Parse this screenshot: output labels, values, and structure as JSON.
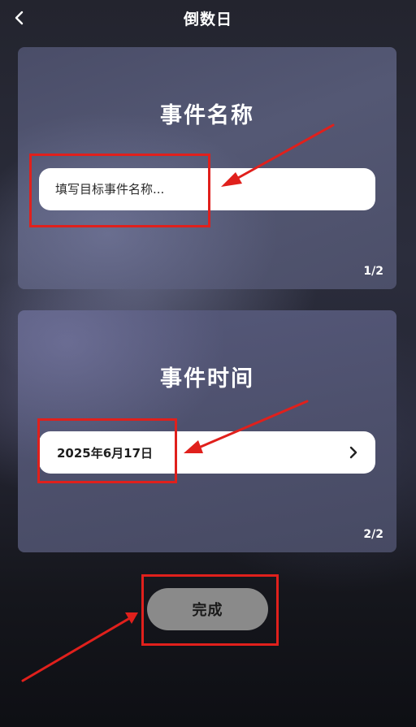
{
  "header": {
    "title": "倒数日",
    "back_icon": "chevron-left-icon"
  },
  "event_name_card": {
    "heading": "事件名称",
    "input_placeholder": "填写目标事件名称...",
    "input_value": "",
    "page_indicator": "1/2"
  },
  "event_time_card": {
    "heading": "事件时间",
    "date_value": "2025年6月17日",
    "chevron_icon": "chevron-right-icon",
    "page_indicator": "2/2"
  },
  "done_button": {
    "label": "完成"
  },
  "colors": {
    "annotation_red": "#e0201c",
    "done_button_bg": "#8a8a8a",
    "card_bg": "#50536e"
  }
}
